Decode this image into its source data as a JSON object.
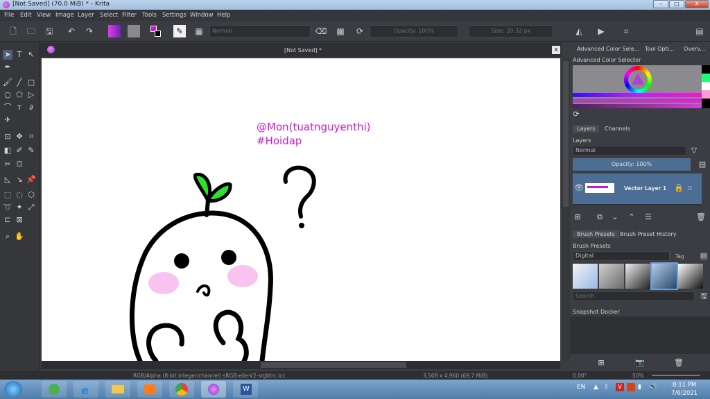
{
  "window": {
    "title": "[Not Saved]  (70.0 MiB)  * - Krita",
    "min": "–",
    "max": "□",
    "close": "X"
  },
  "menu": [
    "File",
    "Edit",
    "View",
    "Image",
    "Layer",
    "Select",
    "Filter",
    "Tools",
    "Settings",
    "Window",
    "Help"
  ],
  "toolbar": {
    "blend_mode": "Normal",
    "opacity": "Opacity: 100%",
    "size": "Size: 20.32 px"
  },
  "document": {
    "tab_title": "[Not Saved]  *",
    "close": "x",
    "text_line1": "@Mon(tuatnguyenthi)",
    "text_line2": "#Hoidap"
  },
  "status": {
    "color_profile": "RGB/Alpha (8-bit integer/channel)  sRGB-elle-V2-srgbtrc.icc",
    "dimensions": "3,508 x 4,960 (69.7 MiB)",
    "angle": "0.00°",
    "zoom": "50%"
  },
  "right": {
    "tabs": [
      "Advanced Color Sele...",
      "Tool Opti...",
      "Overv..."
    ],
    "color_selector_title": "Advanced Color Selector",
    "layer_tabs": [
      "Layers",
      "Channels"
    ],
    "layers_title": "Layers",
    "layer_blend": "Normal",
    "layer_opacity": "Opacity:  100%",
    "layer_name": "Vector Layer 1",
    "preset_tabs": [
      "Brush Presets",
      "Brush Preset History"
    ],
    "presets_title": "Brush Presets",
    "preset_tag_filter": "Digital",
    "tag_label": "Tag",
    "search_placeholder": "Search",
    "snapshot_title": "Snapshot Docker"
  },
  "taskbar": {
    "lang": "EN",
    "time": "8:11 PM",
    "date": "7/6/2021"
  },
  "colors": {
    "accent_magenta": "#cc19cc",
    "layer_selected": "#4d6e94",
    "sprout_green": "#2ee02e"
  }
}
